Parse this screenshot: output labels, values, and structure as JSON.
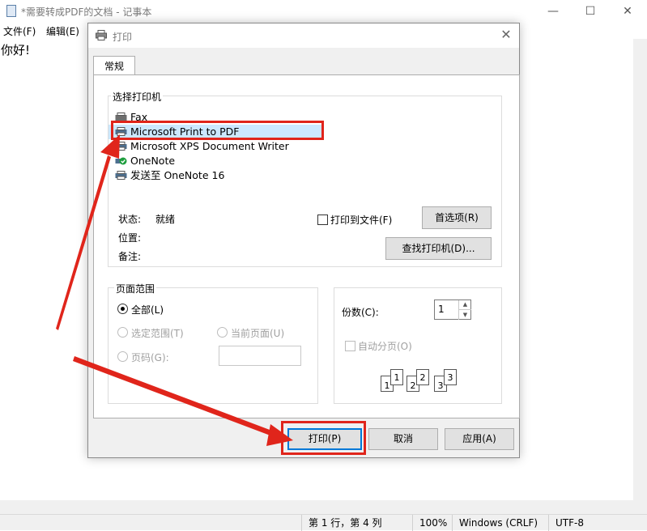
{
  "notepad": {
    "title": "*需要转成PDF的文档 - 记事本",
    "menu": [
      "文件(F)",
      "编辑(E)"
    ],
    "content": "你好!",
    "status": {
      "position": "第 1 行，第 4 列",
      "zoom": "100%",
      "line_ending": "Windows (CRLF)",
      "encoding": "UTF-8"
    }
  },
  "dialog": {
    "title": "打印",
    "tab": "常规",
    "printer_group_label": "选择打印机",
    "printers": [
      "Fax",
      "Microsoft Print to PDF",
      "Microsoft XPS Document Writer",
      "OneNote",
      "发送至 OneNote 16"
    ],
    "selected_printer": "Microsoft Print to PDF",
    "status_label": "状态:",
    "status_value": "就绪",
    "location_label": "位置:",
    "comment_label": "备注:",
    "print_to_file": "打印到文件(F)",
    "preferences_button": "首选项(R)",
    "find_printer_button": "查找打印机(D)...",
    "page_range_label": "页面范围",
    "range_all": "全部(L)",
    "range_selection": "选定范围(T)",
    "range_current": "当前页面(U)",
    "range_pages": "页码(G):",
    "copies_label": "份数(C):",
    "copies_value": "1",
    "collate_label": "自动分页(O)",
    "collate_pages": [
      "1",
      "1",
      "2",
      "2",
      "3",
      "3"
    ],
    "print_button": "打印(P)",
    "cancel_button": "取消",
    "apply_button": "应用(A)"
  },
  "colors": {
    "annotation": "#e0251b",
    "selection": "#cce8ff",
    "default_button_border": "#0078d7"
  }
}
